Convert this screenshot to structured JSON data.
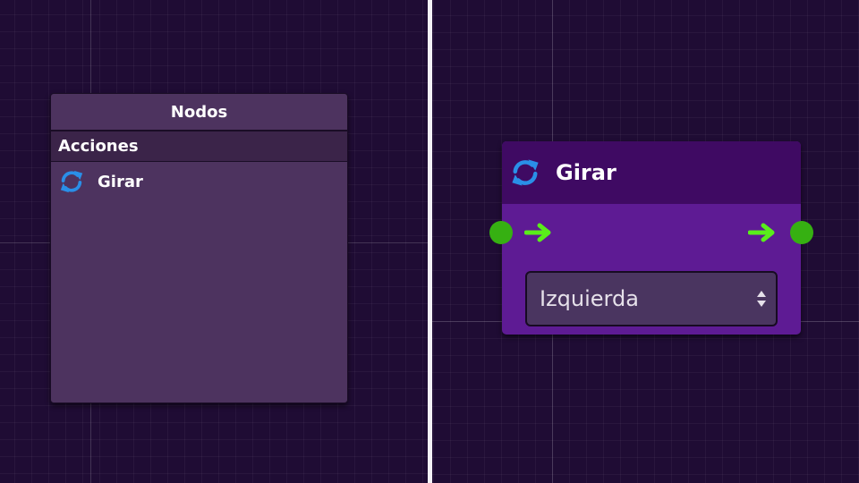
{
  "palette": {
    "title": "Nodos",
    "category": "Acciones",
    "items": [
      {
        "label": "Girar",
        "icon": "rotate-icon"
      }
    ]
  },
  "node": {
    "title": "Girar",
    "icon": "rotate-icon",
    "select": {
      "value": "Izquierda"
    }
  },
  "colors": {
    "canvas_background": "#1f0c34",
    "palette_background": "#4d335f",
    "node_body": "#5e1b94",
    "node_header": "#3f0a63",
    "port": "#36b012",
    "flow_arrow": "#59ee1a",
    "icon_blue": "#2a8fe8"
  }
}
